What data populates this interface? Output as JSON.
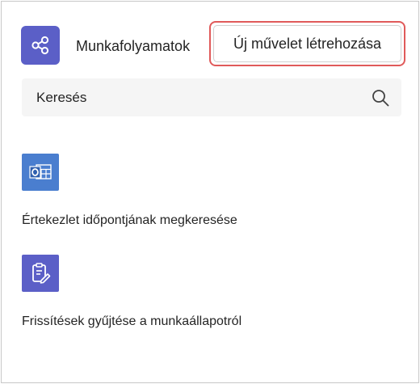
{
  "header": {
    "app_title": "Munkafolyamatok",
    "app_icon": "share-nodes-icon",
    "new_action_label": "Új művelet létrehozása"
  },
  "search": {
    "placeholder": "Keresés",
    "value": "",
    "icon": "search-icon"
  },
  "workflows": [
    {
      "label": "Értekezlet időpontjának megkeresése",
      "icon": "outlook-calendar-icon",
      "color": "#4a7ecf"
    },
    {
      "label": "Frissítések gyűjtése a munkaállapotról",
      "icon": "clipboard-edit-icon",
      "color": "#5b5fc7"
    }
  ],
  "colors": {
    "brand": "#5b5fc7",
    "highlight": "#e05a5a",
    "search_bg": "#f5f5f5"
  }
}
